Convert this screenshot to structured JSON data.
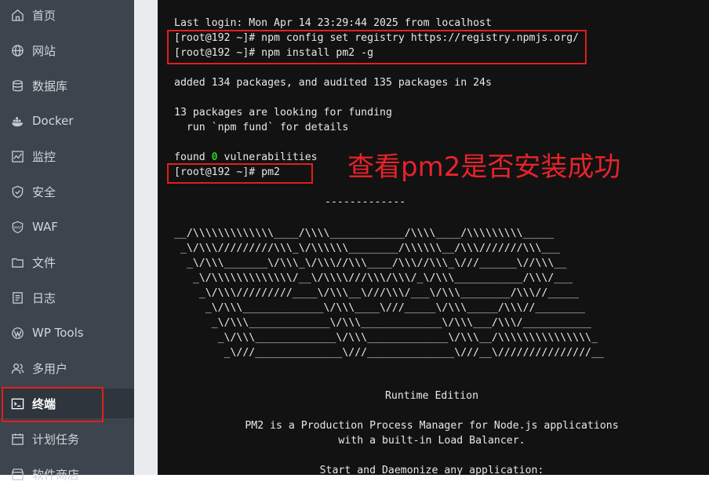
{
  "sidebar": {
    "items": [
      {
        "label": "首页",
        "icon": "home-icon"
      },
      {
        "label": "网站",
        "icon": "globe-icon"
      },
      {
        "label": "数据库",
        "icon": "database-icon"
      },
      {
        "label": "Docker",
        "icon": "docker-icon"
      },
      {
        "label": "监控",
        "icon": "monitor-icon"
      },
      {
        "label": "安全",
        "icon": "shield-icon"
      },
      {
        "label": "WAF",
        "icon": "waf-icon"
      },
      {
        "label": "文件",
        "icon": "folder-icon"
      },
      {
        "label": "日志",
        "icon": "log-icon"
      },
      {
        "label": "WP Tools",
        "icon": "wordpress-icon"
      },
      {
        "label": "多用户",
        "icon": "users-icon"
      },
      {
        "label": "终端",
        "icon": "terminal-icon",
        "active": true
      },
      {
        "label": "计划任务",
        "icon": "calendar-icon"
      },
      {
        "label": "软件商店",
        "icon": "store-icon"
      }
    ]
  },
  "terminal": {
    "login": "Last login: Mon Apr 14 23:29:44 2025 from localhost",
    "cmd1": "[root@192 ~]# npm config set registry https://registry.npmjs.org/",
    "cmd2": "[root@192 ~]# npm install pm2 -g",
    "added": "added 134 packages, and audited 135 packages in 24s",
    "funding1": "13 packages are looking for funding",
    "funding2": "  run `npm fund` for details",
    "found_prefix": "found ",
    "found_count": "0",
    "found_suffix": " vulnerabilities",
    "cmd3": "[root@192 ~]# pm2",
    "dashes": "-------------",
    "ascii": [
      "__/\\\\\\\\\\\\\\\\\\\\\\\\\\____/\\\\\\\\____________/\\\\\\\\____/\\\\\\\\\\\\\\\\\\_____",
      " _\\/\\\\\\/////////\\\\\\_\\/\\\\\\\\\\\\________/\\\\\\\\\\\\__/\\\\\\///////\\\\\\___",
      "  _\\/\\\\\\_______\\/\\\\\\_\\/\\\\\\//\\\\\\____/\\\\\\//\\\\\\_\\///______\\//\\\\\\__",
      "   _\\/\\\\\\\\\\\\\\\\\\\\\\\\\\/__\\/\\\\\\\\///\\\\\\/\\\\\\/_\\/\\\\\\___________/\\\\\\/___",
      "    _\\/\\\\\\/////////____\\/\\\\\\__\\///\\\\\\/___\\/\\\\\\________/\\\\\\//_____",
      "     _\\/\\\\\\_____________\\/\\\\\\____\\///_____\\/\\\\\\_____/\\\\\\//________",
      "      _\\/\\\\\\_____________\\/\\\\\\_____________\\/\\\\\\___/\\\\\\/___________",
      "       _\\/\\\\\\_____________\\/\\\\\\_____________\\/\\\\\\__/\\\\\\\\\\\\\\\\\\\\\\\\\\\\\\_",
      "        _\\///______________\\///______________\\///__\\///////////////__"
    ],
    "runtime": "Runtime Edition",
    "pm2_desc1": "PM2 is a Production Process Manager for Node.js applications",
    "pm2_desc2": "with a built-in Load Balancer.",
    "start": "Start and Daemonize any application:"
  },
  "annotation": "查看pm2是否安装成功",
  "colors": {
    "highlight": "#e21e1e",
    "sidebar_bg": "#3c444d",
    "terminal_bg": "#121212",
    "success": "#2ad12a"
  }
}
